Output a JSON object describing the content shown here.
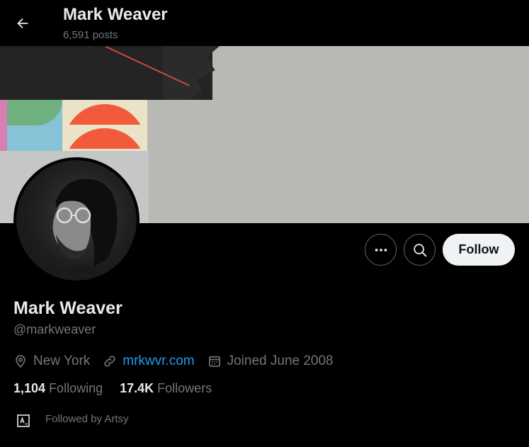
{
  "header": {
    "title": "Mark Weaver",
    "subtitle": "6,591 posts"
  },
  "actions": {
    "follow_label": "Follow"
  },
  "profile": {
    "name": "Mark Weaver",
    "handle": "@markweaver",
    "location": "New York",
    "website": "mrkwvr.com",
    "joined": "Joined June 2008"
  },
  "stats": {
    "following_count": "1,104",
    "following_label": "Following",
    "followers_count": "17.4K",
    "followers_label": "Followers"
  },
  "followed_by": {
    "text": "Followed by Artsy"
  },
  "colors": {
    "background": "#000000",
    "text": "#e7e9ea",
    "muted": "#71767b",
    "link": "#1d9bf0",
    "follow_button_bg": "#eff3f4"
  },
  "icons": {
    "back": "arrow-left-icon",
    "more": "more-dots-icon",
    "search": "search-icon",
    "location": "location-pin-icon",
    "link": "link-icon",
    "calendar": "calendar-icon",
    "followed_by_avatar": "artsy-logo-icon"
  }
}
